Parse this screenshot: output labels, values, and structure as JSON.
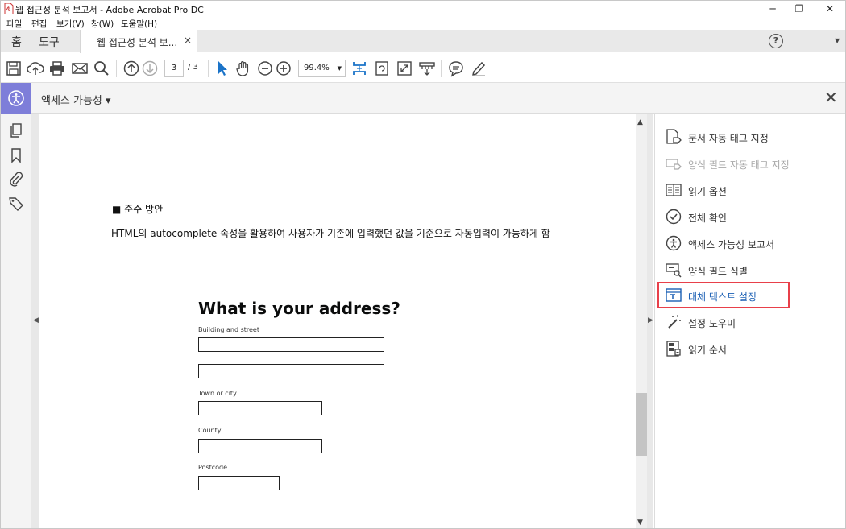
{
  "window": {
    "title": "웹 접근성 분석 보고서 - Adobe Acrobat Pro DC",
    "minimize": "─",
    "restore": "❐",
    "close": "✕"
  },
  "menu": [
    "파일",
    "편집",
    "보기(V)",
    "창(W)",
    "도움말(H)"
  ],
  "tabs": {
    "home": "홈",
    "tools": "도구",
    "document": "웹 접근성 분석 보...",
    "document_close": "×",
    "help": "?"
  },
  "toolbar": {
    "current_page": "3",
    "total_pages": "/ 3",
    "zoom": "99.4%"
  },
  "accessibility": {
    "panel_title": "액세스 가능성",
    "dropdown_caret": "▾"
  },
  "document": {
    "bullet_heading": "■  준수 방안",
    "body": "HTML의 autocomplete 속성을 활용하여 사용자가 기존에 입력했던 값을 기준으로 자동입력이 가능하게 함",
    "form": {
      "title": "What is your address?",
      "labels": {
        "building": "Building and street",
        "town": "Town or city",
        "county": "County",
        "postcode": "Postcode"
      }
    }
  },
  "tools": [
    {
      "label": "문서 자동 태그 지정",
      "icon": "auto-tag-icon",
      "state": "enabled"
    },
    {
      "label": "양식 필드 자동 태그 지정",
      "icon": "form-field-tag-icon",
      "state": "disabled"
    },
    {
      "label": "읽기 옵션",
      "icon": "reading-options-icon",
      "state": "enabled"
    },
    {
      "label": "전체 확인",
      "icon": "full-check-icon",
      "state": "enabled"
    },
    {
      "label": "액세스 가능성 보고서",
      "icon": "accessibility-report-icon",
      "state": "enabled"
    },
    {
      "label": "양식 필드 식별",
      "icon": "identify-form-fields-icon",
      "state": "enabled"
    },
    {
      "label": "대체 텍스트 설정",
      "icon": "set-alt-text-icon",
      "state": "active"
    },
    {
      "label": "설정 도우미",
      "icon": "setup-assistant-icon",
      "state": "enabled"
    },
    {
      "label": "읽기 순서",
      "icon": "reading-order-icon",
      "state": "enabled"
    }
  ],
  "colors": {
    "accent": "#7e7ed9",
    "highlight": "#e8404a",
    "active_text": "#1a5fb4",
    "toolbar_blue": "#1a73c8"
  }
}
